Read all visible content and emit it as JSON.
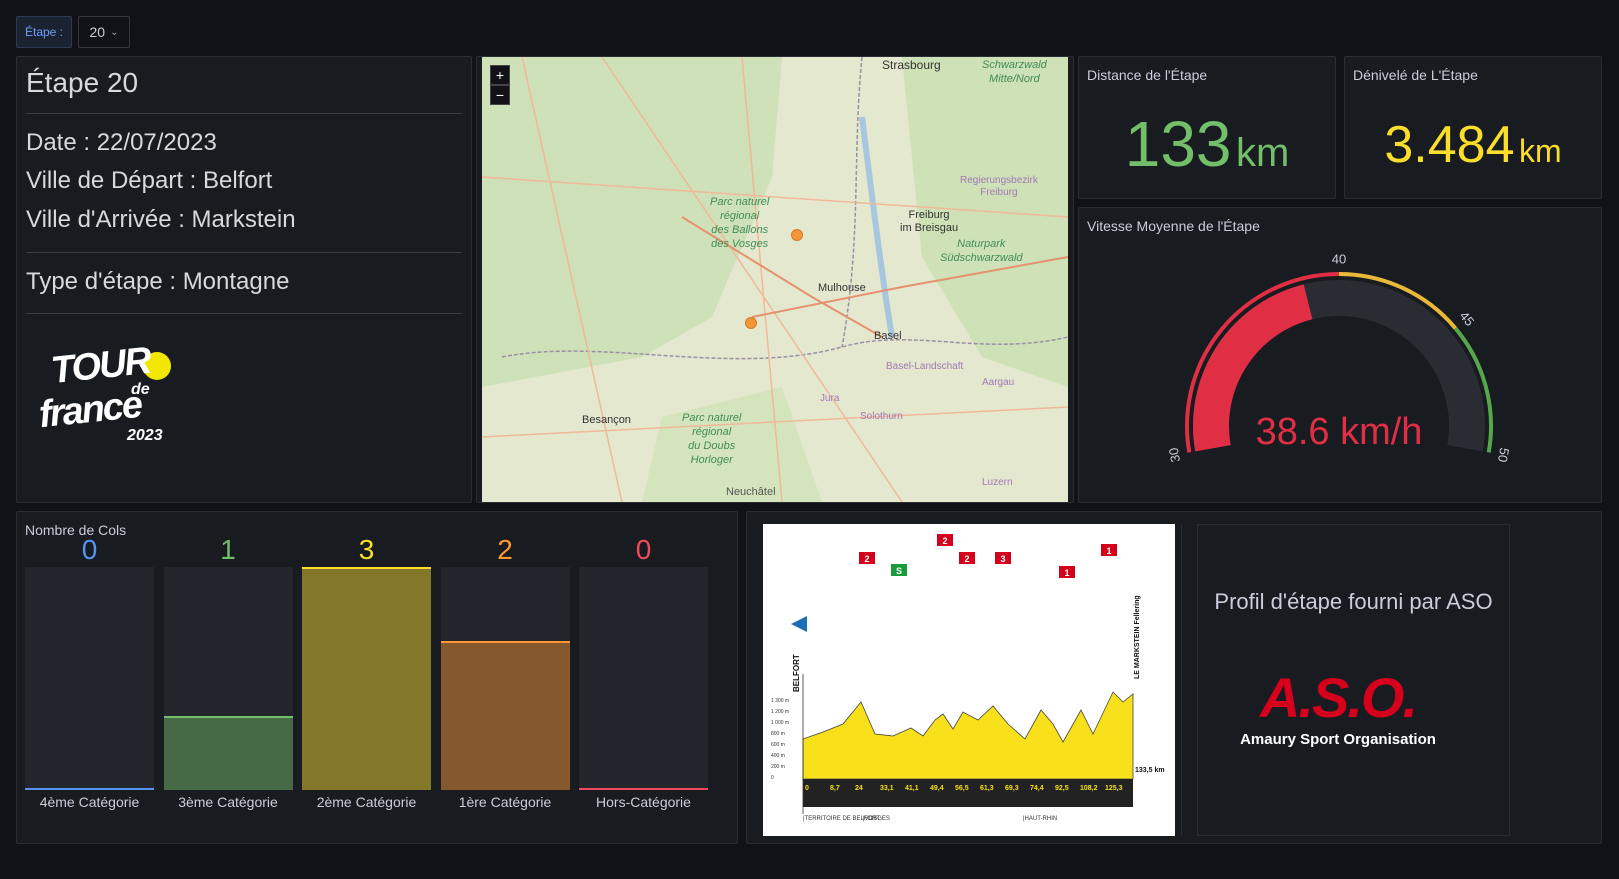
{
  "variable": {
    "label": "Étape :",
    "value": "20"
  },
  "info": {
    "title": "Étape 20",
    "date": "Date : 22/07/2023",
    "depart": "Ville de Départ : Belfort",
    "arrivee": "Ville d'Arrivée : Markstein",
    "type": "Type d'étape : Montagne",
    "logo": {
      "line1": "TOUR",
      "line2": "de",
      "line3": "france",
      "year": "2023"
    }
  },
  "map": {
    "zoom_in": "+",
    "zoom_out": "−",
    "labels": {
      "strasbourg": "Strasbourg",
      "freiburg": "Freiburg\nim Breisgau",
      "mulhouse": "Mulhouse",
      "basel": "Basel",
      "besancon": "Besançon",
      "jura": "Jura",
      "solothurn": "Solothurn",
      "aargau": "Aargau",
      "luzern": "Luzern",
      "neuchatel": "Neuchâtel",
      "basel_landschaft": "Basel-Landschaft",
      "regierungsbezirk": "Regierungsbezirk\nFreiburg",
      "schwarzwald_mitte": "Schwarzwald\nMitte/Nord",
      "park_vosges": "Parc naturel\nrégional\ndes Ballons\ndes Vosges",
      "park_sud": "Naturpark\nSüdschwarzwald",
      "park_doubs": "Parc naturel\nrégional\ndu Doubs\nHorloger"
    },
    "marker_color": "#f5953a"
  },
  "stats": {
    "distance": {
      "title": "Distance de l'Étape",
      "value": "133",
      "unit": "km",
      "color": "#73bf69"
    },
    "denivele": {
      "title": "Dénivelé de L'Étape",
      "value": "3.484",
      "unit": "km",
      "color": "#fade2a"
    }
  },
  "gauge": {
    "title": "Vitesse Moyenne de l'Étape",
    "value": 38.6,
    "display": "38.6 km/h",
    "min": 30,
    "max": 50,
    "thresholds": [
      {
        "from": 30,
        "to": 40,
        "color": "#e02f44"
      },
      {
        "from": 40,
        "to": 45,
        "color": "#eab839"
      },
      {
        "from": 45,
        "to": 50,
        "color": "#56a64b"
      }
    ],
    "ticks": [
      "30",
      "40",
      "45",
      "50"
    ]
  },
  "cols": {
    "title": "Nombre de Cols",
    "max": 3,
    "items": [
      {
        "label": "4ème Catégorie",
        "value": 0,
        "display": "0",
        "color": "#5794f2"
      },
      {
        "label": "3ème Catégorie",
        "value": 1,
        "display": "1",
        "color": "#73bf69"
      },
      {
        "label": "2ème Catégorie",
        "value": 3,
        "display": "3",
        "color": "#fade2a"
      },
      {
        "label": "1ère Catégorie",
        "value": 2,
        "display": "2",
        "color": "#ff9830"
      },
      {
        "label": "Hors-Catégorie",
        "value": 0,
        "display": "0",
        "color": "#f2495c"
      }
    ]
  },
  "profile": {
    "start": "BELFORT",
    "finish": "LE MARKSTEIN Fellering",
    "distance": "133,5 km",
    "caption": "Profil d'étape fourni par ASO",
    "aso_logo": "A.S.O.",
    "aso_name": "Amaury Sport Organisation",
    "regions": [
      "TERRITOIRE DE BELFORT",
      "VOSGES",
      "HAUT-RHIN"
    ],
    "km_marks": [
      "0",
      "8,7",
      "24",
      "33,1",
      "41,1",
      "49,4",
      "56,5",
      "61,3",
      "69,3",
      "74,4",
      "92,5",
      "108,2",
      "125,3"
    ],
    "elev_labels": [
      "1 300 m",
      "1 200 m",
      "1 000 m",
      "800 m",
      "600 m",
      "400 m",
      "200 m",
      "0"
    ],
    "cat_badges": [
      "2",
      "S",
      "2",
      "2",
      "3",
      "1",
      "1"
    ]
  }
}
